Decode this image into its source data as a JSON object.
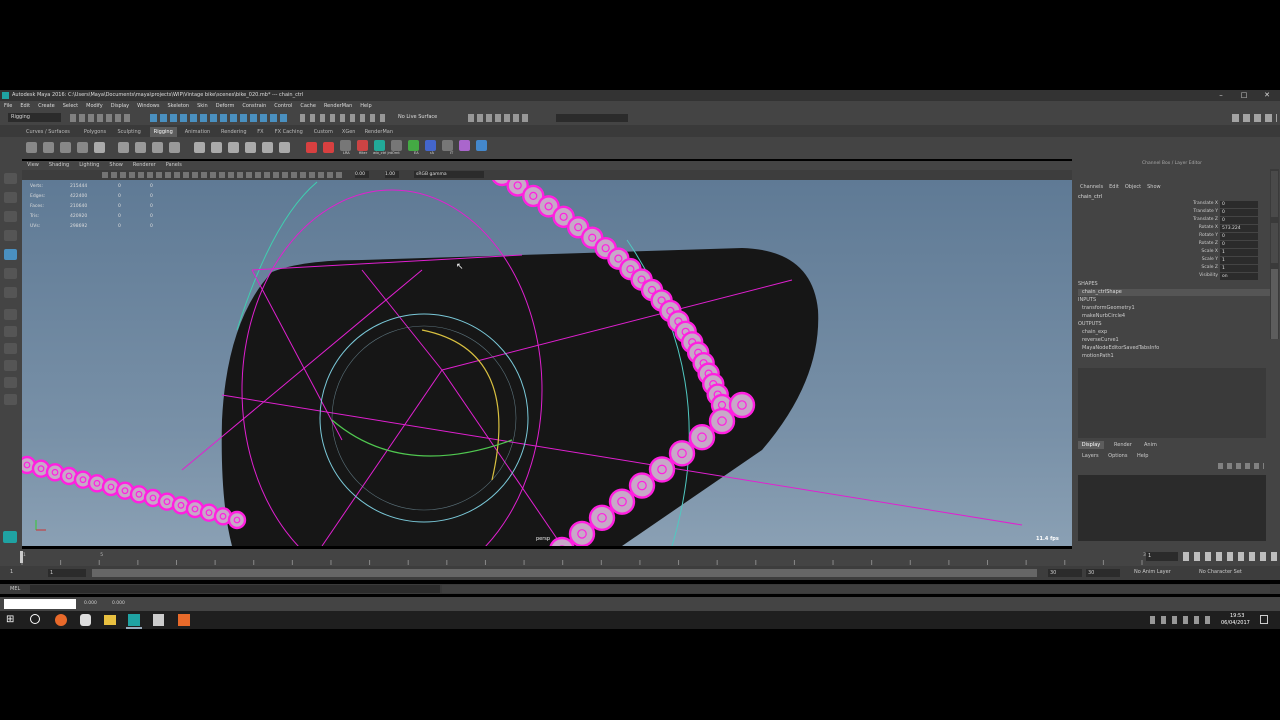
{
  "window": {
    "title": "Autodesk Maya 2016: C:\\Users\\Maya\\Documents\\maya\\projects\\WIP\\Vintage bike\\scenes\\bike_020.mb* --- chain_ctrl"
  },
  "menu": [
    "File",
    "Edit",
    "Create",
    "Select",
    "Modify",
    "Display",
    "Windows",
    "Skeleton",
    "Skin",
    "Deform",
    "Constrain",
    "Control",
    "Cache",
    "RenderMan",
    "Help"
  ],
  "status": {
    "mode": "Rigging",
    "live_surface": "No Live Surface"
  },
  "shelf_tabs": [
    "Curves / Surfaces",
    "Polygons",
    "Sculpting",
    "Rigging",
    "Animation",
    "Rendering",
    "FX",
    "FX Caching",
    "Custom",
    "XGen",
    "RenderMan"
  ],
  "active_shelf_tab": "Rigging",
  "shelf_labels": [
    "LRA",
    "filter",
    "wix_ctrl jntOrnt",
    "EA",
    "rA",
    "IT"
  ],
  "panel_menu": [
    "View",
    "Shading",
    "Lighting",
    "Show",
    "Renderer",
    "Panels"
  ],
  "panel_toolbar": {
    "value1": "0.00",
    "value2": "1.00",
    "colorspace": "sRGB gamma"
  },
  "hud": [
    {
      "label": "Verts:",
      "v1": "215444",
      "v2": "0",
      "v3": "0"
    },
    {
      "label": "Edges:",
      "v1": "422400",
      "v2": "0",
      "v3": "0"
    },
    {
      "label": "Faces:",
      "v1": "210640",
      "v2": "0",
      "v3": "0"
    },
    {
      "label": "Tris:",
      "v1": "420920",
      "v2": "0",
      "v3": "0"
    },
    {
      "label": "UVs:",
      "v1": "298692",
      "v2": "0",
      "v3": "0"
    }
  ],
  "viewport": {
    "camera": "persp",
    "fps": "11.4 fps"
  },
  "channel_box": {
    "header": "Channel Box / Layer Editor",
    "menu": [
      "Channels",
      "Edit",
      "Object",
      "Show"
    ],
    "object": "chain_ctrl",
    "attributes": [
      {
        "name": "Translate X",
        "value": "0"
      },
      {
        "name": "Translate Y",
        "value": "0"
      },
      {
        "name": "Translate Z",
        "value": "0"
      },
      {
        "name": "Rotate X",
        "value": "573.224"
      },
      {
        "name": "Rotate Y",
        "value": "0"
      },
      {
        "name": "Rotate Z",
        "value": "0"
      },
      {
        "name": "Scale X",
        "value": "1"
      },
      {
        "name": "Scale Y",
        "value": "1"
      },
      {
        "name": "Scale Z",
        "value": "1"
      },
      {
        "name": "Visibility",
        "value": "on"
      }
    ],
    "shapes_label": "SHAPES",
    "shapes": [
      "chain_ctrlShape"
    ],
    "inputs_label": "INPUTS",
    "inputs": [
      "transformGeometry1",
      "makeNurbCircle4"
    ],
    "outputs_label": "OUTPUTS",
    "outputs": [
      "chain_exp",
      "reverseCurve1",
      "MayaNodeEditorSavedTabsInfo",
      "motionPath1"
    ],
    "layer_tabs": [
      "Display",
      "Render",
      "Anim"
    ],
    "layer_menu": [
      "Layers",
      "Options",
      "Help"
    ]
  },
  "side_tabs": [
    "Attribute Editor",
    "Tool Settings",
    "Channel Box / Layer Editor"
  ],
  "timeline": {
    "ticks": [
      "1",
      "",
      "5",
      "",
      "",
      "",
      "",
      "",
      "",
      "",
      "",
      "",
      "",
      "",
      "",
      "",
      "",
      "",
      "",
      "",
      "",
      "",
      "",
      "",
      "",
      "",
      "",
      "",
      "",
      "30"
    ],
    "current_frame": "1"
  },
  "range": {
    "start": "1",
    "range_start": "1",
    "range_end": "30",
    "end": "30",
    "anim_layer": "No Anim Layer",
    "char_set": "No Character Set"
  },
  "command_line": {
    "lang": "MEL"
  },
  "help_line": {
    "v1": "0.000",
    "v2": "0.000"
  },
  "taskbar": {
    "time": "19:53",
    "date": "06/04/2017"
  }
}
